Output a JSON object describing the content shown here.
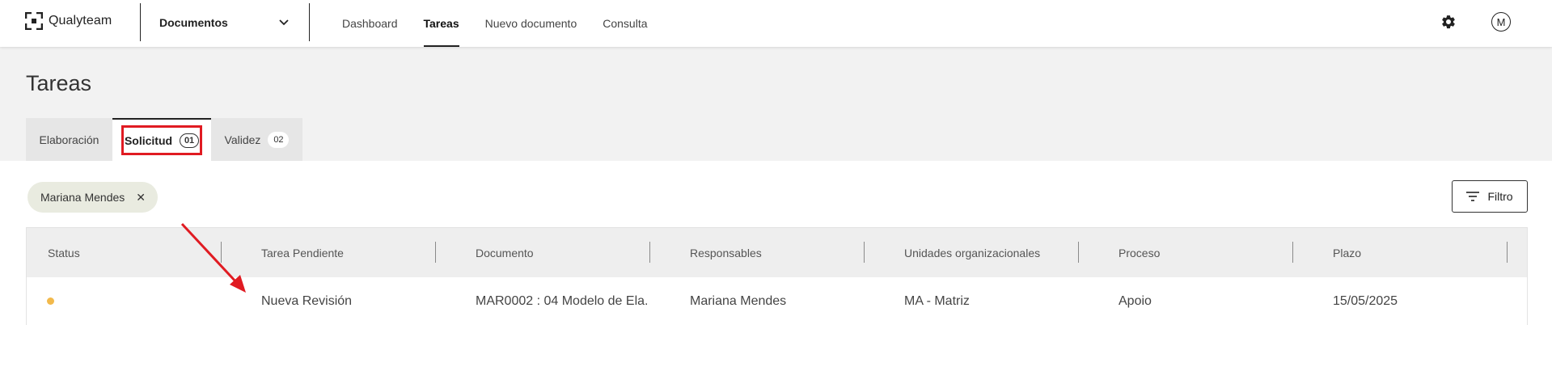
{
  "app": {
    "name": "Qualyteam"
  },
  "header": {
    "module_select": "Documentos",
    "nav": [
      {
        "label": "Dashboard",
        "active": false
      },
      {
        "label": "Tareas",
        "active": true
      },
      {
        "label": "Nuevo documento",
        "active": false
      },
      {
        "label": "Consulta",
        "active": false
      }
    ],
    "settings_icon": "gear-icon",
    "avatar_initial": "M"
  },
  "page": {
    "title": "Tareas",
    "tabs": [
      {
        "label": "Elaboración",
        "count": null,
        "active": false
      },
      {
        "label": "Solicitud",
        "count": "01",
        "active": true
      },
      {
        "label": "Validez",
        "count": "02",
        "active": false
      }
    ]
  },
  "filters": {
    "chips": [
      {
        "label": "Mariana Mendes"
      }
    ],
    "filter_button": "Filtro"
  },
  "table": {
    "columns": [
      "Status",
      "Tarea Pendiente",
      "Documento",
      "Responsables",
      "Unidades organizacionales",
      "Proceso",
      "Plazo"
    ],
    "rows": [
      {
        "status_color": "#f2b94b",
        "tarea": "Nueva Revisión",
        "documento": "MAR0002 : 04 Modelo de Ela...",
        "responsables": "Mariana Mendes",
        "unidades": "MA - Matriz",
        "proceso": "Apoio",
        "plazo": "15/05/2025"
      }
    ]
  },
  "colors": {
    "accent_dark": "#222222",
    "highlight": "#e01b22",
    "chip_bg": "#e9ebe0",
    "status_pending": "#f2b94b"
  }
}
